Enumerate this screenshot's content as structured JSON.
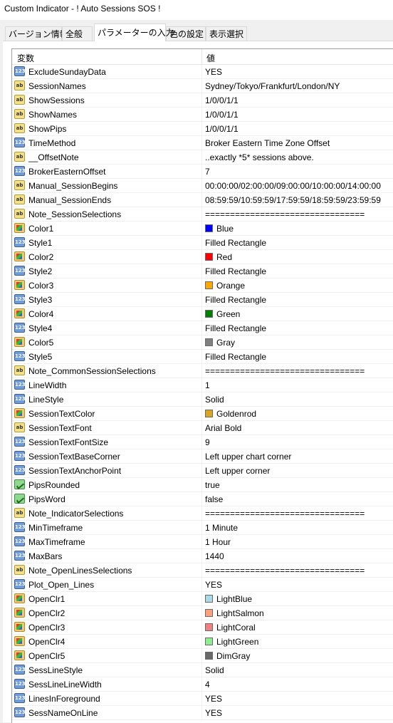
{
  "window": {
    "title": "Custom Indicator - ! Auto Sessions SOS !"
  },
  "tabs": [
    {
      "label": "バージョン情報"
    },
    {
      "label": "全般"
    },
    {
      "label": "パラメーターの入力"
    },
    {
      "label": "色の設定"
    },
    {
      "label": "表示選択"
    }
  ],
  "grid": {
    "col_variable": "変数",
    "col_value": "値"
  },
  "rows": [
    {
      "icon": "t-num",
      "name": "ExcludeSundayData",
      "value": "YES"
    },
    {
      "icon": "t-ab",
      "name": "SessionNames",
      "value": "Sydney/Tokyo/Frankfurt/London/NY"
    },
    {
      "icon": "t-ab",
      "name": "ShowSessions",
      "value": "1/0/0/1/1"
    },
    {
      "icon": "t-ab",
      "name": "ShowNames",
      "value": "1/0/0/1/1"
    },
    {
      "icon": "t-ab",
      "name": "ShowPips",
      "value": "1/0/0/1/1"
    },
    {
      "icon": "t-num",
      "name": "TimeMethod",
      "value": "Broker Eastern Time Zone Offset"
    },
    {
      "icon": "t-ab",
      "name": "__OffsetNote",
      "value": "..exactly *5* sessions above."
    },
    {
      "icon": "t-num",
      "name": "BrokerEasternOffset",
      "value": "7"
    },
    {
      "icon": "t-ab",
      "name": "Manual_SessionBegins",
      "value": "00:00:00/02:00:00/09:00:00/10:00:00/14:00:00"
    },
    {
      "icon": "t-ab",
      "name": "Manual_SessionEnds",
      "value": "08:59:59/10:59:59/17:59:59/18:59:59/23:59:59"
    },
    {
      "icon": "t-ab",
      "name": "Note_SessionSelections",
      "value": "================================"
    },
    {
      "icon": "t-color",
      "name": "Color1",
      "value": "Blue",
      "swatch": "#0000ff"
    },
    {
      "icon": "t-num",
      "name": "Style1",
      "value": "Filled Rectangle"
    },
    {
      "icon": "t-color",
      "name": "Color2",
      "value": "Red",
      "swatch": "#ff0000"
    },
    {
      "icon": "t-num",
      "name": "Style2",
      "value": "Filled Rectangle"
    },
    {
      "icon": "t-color",
      "name": "Color3",
      "value": "Orange",
      "swatch": "#ffa500"
    },
    {
      "icon": "t-num",
      "name": "Style3",
      "value": "Filled Rectangle"
    },
    {
      "icon": "t-color",
      "name": "Color4",
      "value": "Green",
      "swatch": "#008000"
    },
    {
      "icon": "t-num",
      "name": "Style4",
      "value": "Filled Rectangle"
    },
    {
      "icon": "t-color",
      "name": "Color5",
      "value": "Gray",
      "swatch": "#808080"
    },
    {
      "icon": "t-num",
      "name": "Style5",
      "value": "Filled Rectangle"
    },
    {
      "icon": "t-ab",
      "name": "Note_CommonSessionSelections",
      "value": "================================"
    },
    {
      "icon": "t-num",
      "name": "LineWidth",
      "value": "1"
    },
    {
      "icon": "t-num",
      "name": "LineStyle",
      "value": "Solid"
    },
    {
      "icon": "t-color",
      "name": "SessionTextColor",
      "value": "Goldenrod",
      "swatch": "#daa520"
    },
    {
      "icon": "t-ab",
      "name": "SessionTextFont",
      "value": "Arial Bold"
    },
    {
      "icon": "t-num",
      "name": "SessionTextFontSize",
      "value": "9"
    },
    {
      "icon": "t-num",
      "name": "SessionTextBaseCorner",
      "value": "Left upper chart corner"
    },
    {
      "icon": "t-num",
      "name": "SessionTextAnchorPoint",
      "value": "Left upper corner"
    },
    {
      "icon": "t-bool",
      "name": "PipsRounded",
      "value": "true"
    },
    {
      "icon": "t-bool",
      "name": "PipsWord",
      "value": "false"
    },
    {
      "icon": "t-ab",
      "name": "Note_IndicatorSelections",
      "value": "================================"
    },
    {
      "icon": "t-num",
      "name": "MinTimeframe",
      "value": "1 Minute"
    },
    {
      "icon": "t-num",
      "name": "MaxTimeframe",
      "value": "1 Hour"
    },
    {
      "icon": "t-num",
      "name": "MaxBars",
      "value": "1440"
    },
    {
      "icon": "t-ab",
      "name": "Note_OpenLinesSelections",
      "value": "================================"
    },
    {
      "icon": "t-num",
      "name": "Plot_Open_Lines",
      "value": "YES"
    },
    {
      "icon": "t-color",
      "name": "OpenClr1",
      "value": "LightBlue",
      "swatch": "#add8e6"
    },
    {
      "icon": "t-color",
      "name": "OpenClr2",
      "value": "LightSalmon",
      "swatch": "#ffa07a"
    },
    {
      "icon": "t-color",
      "name": "OpenClr3",
      "value": "LightCoral",
      "swatch": "#f08080"
    },
    {
      "icon": "t-color",
      "name": "OpenClr4",
      "value": "LightGreen",
      "swatch": "#90ee90"
    },
    {
      "icon": "t-color",
      "name": "OpenClr5",
      "value": "DimGray",
      "swatch": "#696969"
    },
    {
      "icon": "t-num",
      "name": "SessLineStyle",
      "value": "Solid"
    },
    {
      "icon": "t-num",
      "name": "SessLineLineWidth",
      "value": "4"
    },
    {
      "icon": "t-num",
      "name": "LinesInForeground",
      "value": "YES"
    },
    {
      "icon": "t-num",
      "name": "SessNameOnLine",
      "value": "YES"
    }
  ]
}
